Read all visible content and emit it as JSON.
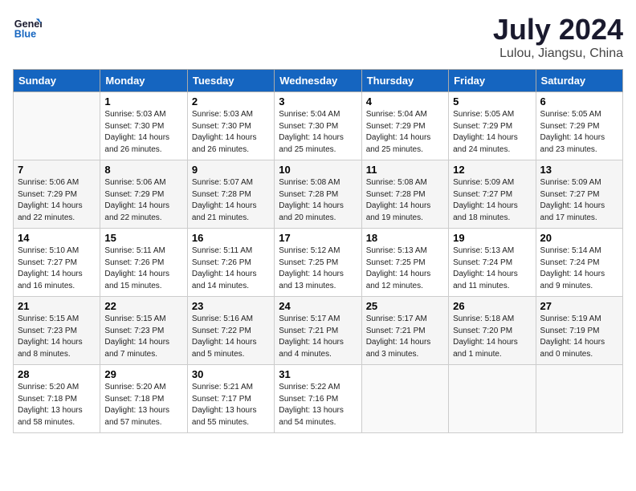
{
  "header": {
    "logo_line1": "General",
    "logo_line2": "Blue",
    "month_year": "July 2024",
    "location": "Lulou, Jiangsu, China"
  },
  "weekdays": [
    "Sunday",
    "Monday",
    "Tuesday",
    "Wednesday",
    "Thursday",
    "Friday",
    "Saturday"
  ],
  "weeks": [
    [
      {
        "day": "",
        "info": ""
      },
      {
        "day": "1",
        "info": "Sunrise: 5:03 AM\nSunset: 7:30 PM\nDaylight: 14 hours\nand 26 minutes."
      },
      {
        "day": "2",
        "info": "Sunrise: 5:03 AM\nSunset: 7:30 PM\nDaylight: 14 hours\nand 26 minutes."
      },
      {
        "day": "3",
        "info": "Sunrise: 5:04 AM\nSunset: 7:30 PM\nDaylight: 14 hours\nand 25 minutes."
      },
      {
        "day": "4",
        "info": "Sunrise: 5:04 AM\nSunset: 7:29 PM\nDaylight: 14 hours\nand 25 minutes."
      },
      {
        "day": "5",
        "info": "Sunrise: 5:05 AM\nSunset: 7:29 PM\nDaylight: 14 hours\nand 24 minutes."
      },
      {
        "day": "6",
        "info": "Sunrise: 5:05 AM\nSunset: 7:29 PM\nDaylight: 14 hours\nand 23 minutes."
      }
    ],
    [
      {
        "day": "7",
        "info": "Sunrise: 5:06 AM\nSunset: 7:29 PM\nDaylight: 14 hours\nand 22 minutes."
      },
      {
        "day": "8",
        "info": "Sunrise: 5:06 AM\nSunset: 7:29 PM\nDaylight: 14 hours\nand 22 minutes."
      },
      {
        "day": "9",
        "info": "Sunrise: 5:07 AM\nSunset: 7:28 PM\nDaylight: 14 hours\nand 21 minutes."
      },
      {
        "day": "10",
        "info": "Sunrise: 5:08 AM\nSunset: 7:28 PM\nDaylight: 14 hours\nand 20 minutes."
      },
      {
        "day": "11",
        "info": "Sunrise: 5:08 AM\nSunset: 7:28 PM\nDaylight: 14 hours\nand 19 minutes."
      },
      {
        "day": "12",
        "info": "Sunrise: 5:09 AM\nSunset: 7:27 PM\nDaylight: 14 hours\nand 18 minutes."
      },
      {
        "day": "13",
        "info": "Sunrise: 5:09 AM\nSunset: 7:27 PM\nDaylight: 14 hours\nand 17 minutes."
      }
    ],
    [
      {
        "day": "14",
        "info": "Sunrise: 5:10 AM\nSunset: 7:27 PM\nDaylight: 14 hours\nand 16 minutes."
      },
      {
        "day": "15",
        "info": "Sunrise: 5:11 AM\nSunset: 7:26 PM\nDaylight: 14 hours\nand 15 minutes."
      },
      {
        "day": "16",
        "info": "Sunrise: 5:11 AM\nSunset: 7:26 PM\nDaylight: 14 hours\nand 14 minutes."
      },
      {
        "day": "17",
        "info": "Sunrise: 5:12 AM\nSunset: 7:25 PM\nDaylight: 14 hours\nand 13 minutes."
      },
      {
        "day": "18",
        "info": "Sunrise: 5:13 AM\nSunset: 7:25 PM\nDaylight: 14 hours\nand 12 minutes."
      },
      {
        "day": "19",
        "info": "Sunrise: 5:13 AM\nSunset: 7:24 PM\nDaylight: 14 hours\nand 11 minutes."
      },
      {
        "day": "20",
        "info": "Sunrise: 5:14 AM\nSunset: 7:24 PM\nDaylight: 14 hours\nand 9 minutes."
      }
    ],
    [
      {
        "day": "21",
        "info": "Sunrise: 5:15 AM\nSunset: 7:23 PM\nDaylight: 14 hours\nand 8 minutes."
      },
      {
        "day": "22",
        "info": "Sunrise: 5:15 AM\nSunset: 7:23 PM\nDaylight: 14 hours\nand 7 minutes."
      },
      {
        "day": "23",
        "info": "Sunrise: 5:16 AM\nSunset: 7:22 PM\nDaylight: 14 hours\nand 5 minutes."
      },
      {
        "day": "24",
        "info": "Sunrise: 5:17 AM\nSunset: 7:21 PM\nDaylight: 14 hours\nand 4 minutes."
      },
      {
        "day": "25",
        "info": "Sunrise: 5:17 AM\nSunset: 7:21 PM\nDaylight: 14 hours\nand 3 minutes."
      },
      {
        "day": "26",
        "info": "Sunrise: 5:18 AM\nSunset: 7:20 PM\nDaylight: 14 hours\nand 1 minute."
      },
      {
        "day": "27",
        "info": "Sunrise: 5:19 AM\nSunset: 7:19 PM\nDaylight: 14 hours\nand 0 minutes."
      }
    ],
    [
      {
        "day": "28",
        "info": "Sunrise: 5:20 AM\nSunset: 7:18 PM\nDaylight: 13 hours\nand 58 minutes."
      },
      {
        "day": "29",
        "info": "Sunrise: 5:20 AM\nSunset: 7:18 PM\nDaylight: 13 hours\nand 57 minutes."
      },
      {
        "day": "30",
        "info": "Sunrise: 5:21 AM\nSunset: 7:17 PM\nDaylight: 13 hours\nand 55 minutes."
      },
      {
        "day": "31",
        "info": "Sunrise: 5:22 AM\nSunset: 7:16 PM\nDaylight: 13 hours\nand 54 minutes."
      },
      {
        "day": "",
        "info": ""
      },
      {
        "day": "",
        "info": ""
      },
      {
        "day": "",
        "info": ""
      }
    ]
  ]
}
